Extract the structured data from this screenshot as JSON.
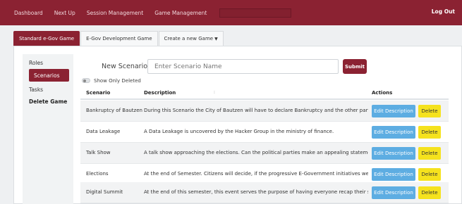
{
  "nav": {
    "links": [
      "Dashboard",
      "Next Up",
      "Session Management",
      "Game Management"
    ],
    "logout": "Log Out"
  },
  "tabs": {
    "items": [
      "Standard e-Gov Game",
      "E-Gov Development Game",
      "Create a new Game"
    ],
    "active_index": 0
  },
  "sidebar": {
    "items": [
      "Roles",
      "Scenarios",
      "Tasks",
      "Delete Game"
    ],
    "active_index": 1
  },
  "form": {
    "label": "New Scenario:",
    "placeholder": "Enter Scenario Name",
    "submit": "Submit",
    "toggle_label": "Show Only Deleted"
  },
  "table": {
    "headers": [
      "Scenario",
      "Description",
      "Actions"
    ],
    "edit_label": "Edit Description",
    "delete_label": "Delete",
    "rows": [
      {
        "name": "Bankruptcy of Bautzen",
        "description": "During this Scenario the City of Bautzen will have to declare Bankruptcy and the other particip[...]"
      },
      {
        "name": "Data Leakage",
        "description": "A Data Leakage is uncovered by the Hacker Group in the ministry of finance."
      },
      {
        "name": "Talk Show",
        "description": "A talk show approaching the elections. Can the political parties make an appealing statement?"
      },
      {
        "name": "Elections",
        "description": "At the end of Semester. Citizens will decide, if the progressive E-Government initiatives were [...]"
      },
      {
        "name": "Digital Summit",
        "description": "At the end of this semester, this event serves the purpose of having everyone recap their simul[...]"
      }
    ]
  },
  "colors": {
    "brand": "#8b2232",
    "edit": "#5dade2",
    "delete": "#f5e21d"
  }
}
